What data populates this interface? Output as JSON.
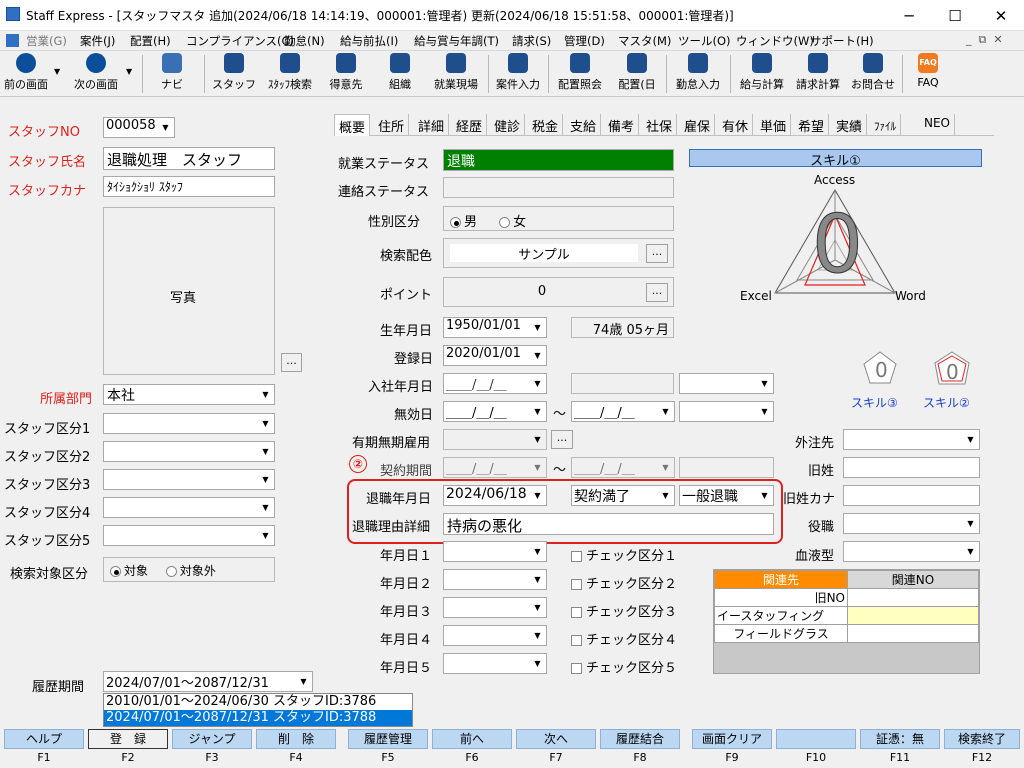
{
  "window": {
    "title": "Staff Express - [スタッフマスタ 追加(2024/06/18 14:14:19、000001:管理者) 更新(2024/06/18 15:51:58、000001:管理者)]"
  },
  "menu": [
    "営業(G)",
    "案件(J)",
    "配置(H)",
    "コンプライアンス(C)",
    "勤怠(N)",
    "給与前払(I)",
    "給与賞与年調(T)",
    "請求(S)",
    "管理(D)",
    "マスタ(M)",
    "ツール(O)",
    "ウィンドウ(W)",
    "サポート(H)"
  ],
  "toolbar": {
    "prev": "前の画面",
    "next": "次の画面",
    "navi": "ナビ",
    "staff": "スタッフ",
    "staff_search": "ｽﾀｯﾌ検索",
    "client": "得意先",
    "org": "組織",
    "site": "就業現場",
    "job_entry": "案件入力",
    "assign_ref": "配置照会",
    "assign_day": "配置(日",
    "attendance": "勤怠入力",
    "pay_calc": "給与計算",
    "bill_calc": "請求計算",
    "inquiry": "お問合せ",
    "faq": "FAQ",
    "faq_icon": "FAQ"
  },
  "left": {
    "staff_no_label": "スタッフNO",
    "staff_no": "000058",
    "staff_name_label": "スタッフ氏名",
    "staff_name": "退職処理　スタッフ",
    "staff_kana_label": "スタッフカナ",
    "staff_kana": "ﾀｲｼｮｸｼｮﾘ ｽﾀｯﾌ",
    "photo_label": "写真",
    "photo_btn": "...",
    "dept_label": "所属部門",
    "dept": "本社",
    "cat1": "スタッフ区分1",
    "cat2": "スタッフ区分2",
    "cat3": "スタッフ区分3",
    "cat4": "スタッフ区分4",
    "cat5": "スタッフ区分5",
    "search_label": "検索対象区分",
    "search_on": "対象",
    "search_off": "対象外",
    "history_label": "履歴期間",
    "history_value": "2024/07/01～2087/12/31",
    "history_opts": [
      "2010/01/01～2024/06/30 スタッフID:3786",
      "2024/07/01～2087/12/31 スタッフID:3788"
    ]
  },
  "tabs": [
    "概要",
    "住所",
    "詳細",
    "経歴",
    "健診",
    "税金",
    "支給",
    "備考",
    "社保",
    "雇保",
    "有休",
    "単価",
    "希望",
    "実績",
    "ﾌｧｲﾙ",
    "NEO"
  ],
  "form": {
    "work_status_label": "就業ステータス",
    "work_status": "退職",
    "contact_status_label": "連絡ステータス",
    "gender_label": "性別区分",
    "male": "男",
    "female": "女",
    "color_label": "検索配色",
    "color_value": "サンプル",
    "dots": "...",
    "point_label": "ポイント",
    "point": "0",
    "birth_label": "生年月日",
    "birth": "1950/01/01",
    "age": "74歳 05ヶ月",
    "reg_label": "登録日",
    "reg": "2020/01/01",
    "join_label": "入社年月日",
    "blank_date": "＿＿/＿/＿",
    "invalid_label": "無効日",
    "tilde": "～",
    "term_label": "有期無期雇用",
    "contract_label": "契約期間",
    "marker": "②",
    "retire_label": "退職年月日",
    "retire_date": "2024/06/18",
    "retire_reason": "契約満了",
    "retire_type": "一般退職",
    "retire_detail_label": "退職理由詳細",
    "retire_detail": "持病の悪化",
    "ymd1": "年月日１",
    "ymd2": "年月日２",
    "ymd3": "年月日３",
    "ymd4": "年月日４",
    "ymd5": "年月日５",
    "chk1": "チェック区分１",
    "chk2": "チェック区分２",
    "chk3": "チェック区分３",
    "chk4": "チェック区分４",
    "chk5": "チェック区分５"
  },
  "right": {
    "skill_title": "スキル①",
    "access": "Access",
    "excel": "Excel",
    "word": "Word",
    "skill_value": "0",
    "skill3": "スキル③",
    "skill2": "スキル②",
    "mini_value": "0",
    "outsourcing_label": "外注先",
    "old_name_label": "旧姓",
    "old_kana_label": "旧姓カナ",
    "role_label": "役職",
    "blood_label": "血液型",
    "rel_h1": "関連先",
    "rel_h2": "関連NO",
    "rel_rows": [
      "旧NO",
      "イースタッフィング",
      "フィールドグラス"
    ]
  },
  "fkeys": [
    {
      "label": "ヘルプ",
      "key": "F1"
    },
    {
      "label": "登　録",
      "key": "F2"
    },
    {
      "label": "ジャンプ",
      "key": "F3"
    },
    {
      "label": "削　除",
      "key": "F4"
    },
    {
      "label": "履歴管理",
      "key": "F5"
    },
    {
      "label": "前へ",
      "key": "F6"
    },
    {
      "label": "次へ",
      "key": "F7"
    },
    {
      "label": "履歴結合",
      "key": "F8"
    },
    {
      "label": "画面クリア",
      "key": "F9"
    },
    {
      "label": "",
      "key": "F10"
    },
    {
      "label": "証憑：無",
      "key": "F11"
    },
    {
      "label": "検索終了",
      "key": "F12"
    }
  ],
  "colors": {
    "status_green": "#008000",
    "annotation_red": "#e0201c",
    "fkey_blue": "#bcd7f2",
    "rel_header_orange": "#ff8c00",
    "rel_yellow": "#ffffc0",
    "skill_header": "#a8c8f0"
  }
}
